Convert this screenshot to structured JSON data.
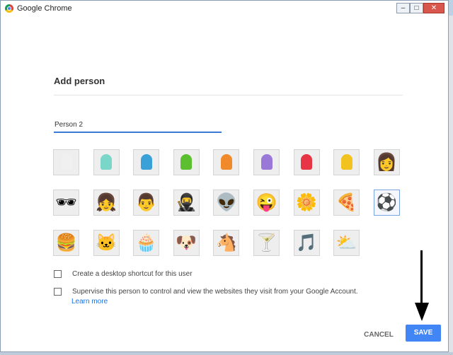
{
  "window": {
    "title": "Google Chrome",
    "minimize": "–",
    "maximize": "□",
    "close": "✕"
  },
  "dialog": {
    "heading": "Add person",
    "name_value": "Person 2",
    "avatars": [
      {
        "name": "gray-head-avatar-icon",
        "glyph": "",
        "color": "#f0f0f0"
      },
      {
        "name": "teal-head-avatar-icon",
        "glyph": "",
        "color": "#7ad6c8"
      },
      {
        "name": "blue-head-avatar-icon",
        "glyph": "",
        "color": "#3aa0d8"
      },
      {
        "name": "green-head-avatar-icon",
        "glyph": "",
        "color": "#5cbf2f"
      },
      {
        "name": "orange-head-avatar-icon",
        "glyph": "",
        "color": "#f08a2a"
      },
      {
        "name": "purple-head-avatar-icon",
        "glyph": "",
        "color": "#9a78d8"
      },
      {
        "name": "red-head-avatar-icon",
        "glyph": "",
        "color": "#e83545"
      },
      {
        "name": "yellow-head-avatar-icon",
        "glyph": "",
        "color": "#f2c21e"
      },
      {
        "name": "blonde-woman-avatar-icon",
        "glyph": "👩",
        "color": ""
      },
      {
        "name": "sunglasses-man-avatar-icon",
        "glyph": "🕶",
        "color": ""
      },
      {
        "name": "woman-sunglasses-avatar-icon",
        "glyph": "👧",
        "color": ""
      },
      {
        "name": "businessman-avatar-icon",
        "glyph": "👨",
        "color": ""
      },
      {
        "name": "ninja-avatar-icon",
        "glyph": "🥷",
        "color": ""
      },
      {
        "name": "alien-avatar-icon",
        "glyph": "👽",
        "color": ""
      },
      {
        "name": "smiley-avatar-icon",
        "glyph": "😜",
        "color": ""
      },
      {
        "name": "flower-avatar-icon",
        "glyph": "🌼",
        "color": ""
      },
      {
        "name": "pizza-avatar-icon",
        "glyph": "🍕",
        "color": ""
      },
      {
        "name": "soccer-ball-avatar-icon",
        "glyph": "⚽",
        "color": ""
      },
      {
        "name": "burger-avatar-icon",
        "glyph": "🍔",
        "color": ""
      },
      {
        "name": "cat-avatar-icon",
        "glyph": "🐱",
        "color": ""
      },
      {
        "name": "cupcake-avatar-icon",
        "glyph": "🧁",
        "color": ""
      },
      {
        "name": "dog-avatar-icon",
        "glyph": "🐶",
        "color": ""
      },
      {
        "name": "horse-avatar-icon",
        "glyph": "🐴",
        "color": ""
      },
      {
        "name": "cocktail-avatar-icon",
        "glyph": "🍸",
        "color": ""
      },
      {
        "name": "music-note-avatar-icon",
        "glyph": "🎵",
        "color": ""
      },
      {
        "name": "sun-cloud-avatar-icon",
        "glyph": "⛅",
        "color": ""
      }
    ],
    "selected_avatar": "soccer-ball-avatar-icon",
    "desktop_shortcut_label": "Create a desktop shortcut for this user",
    "supervise_label": "Supervise this person to control and view the websites they visit from your Google Account.",
    "learn_more": "Learn more",
    "cancel_label": "CANCEL",
    "save_label": "SAVE"
  },
  "colors": {
    "accent": "#4285f4",
    "link": "#1a73e8"
  }
}
